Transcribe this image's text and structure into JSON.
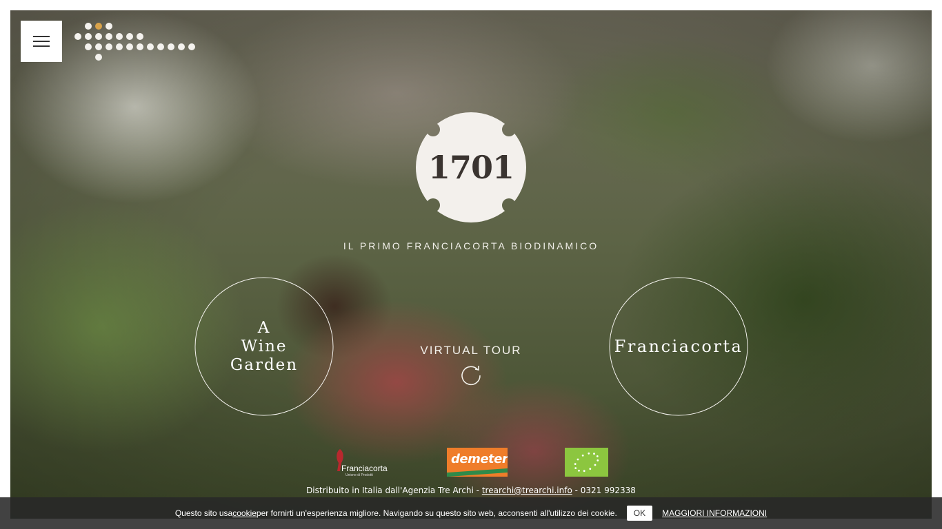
{
  "menu": {
    "icon": "hamburger-icon"
  },
  "brand": {
    "emblem_text": "1701",
    "tagline": "IL PRIMO FRANCIACORTA BIODINAMICO"
  },
  "badges": {
    "left": {
      "lines": [
        "A",
        "Wine",
        "Garden"
      ]
    },
    "right": {
      "label": "Franciacorta"
    }
  },
  "virtual_tour": {
    "label": "VIRTUAL TOUR",
    "icon": "refresh-icon"
  },
  "certifications": {
    "franciacorta": {
      "name": "Franciacorta",
      "sub": "Unione di Prodotti"
    },
    "demeter": {
      "name": "demeter"
    },
    "eu_organic": {
      "name": "eu-organic-logo"
    }
  },
  "footer": {
    "distrib_prefix": "Distribuito in Italia dall'Agenzia Tre Archi - ",
    "email": "trearchi@trearchi.info",
    "phone_suffix": " - 0321 992338"
  },
  "cookie_bar": {
    "text_before": "Questo sito usa ",
    "cookie_link": "cookie",
    "text_after": " per fornirti un'esperienza migliore. Navigando su questo sito web, acconsenti all'utilizzo dei cookie.",
    "ok_label": "OK",
    "more_label": "MAGGIORI INFORMAZIONI"
  },
  "colors": {
    "dot": "#f4f2ee",
    "dot_accent": "#d9a34a",
    "demeter_orange": "#ef7d2a",
    "demeter_green": "#2f8a4a",
    "eu_green": "#8cc63f"
  }
}
